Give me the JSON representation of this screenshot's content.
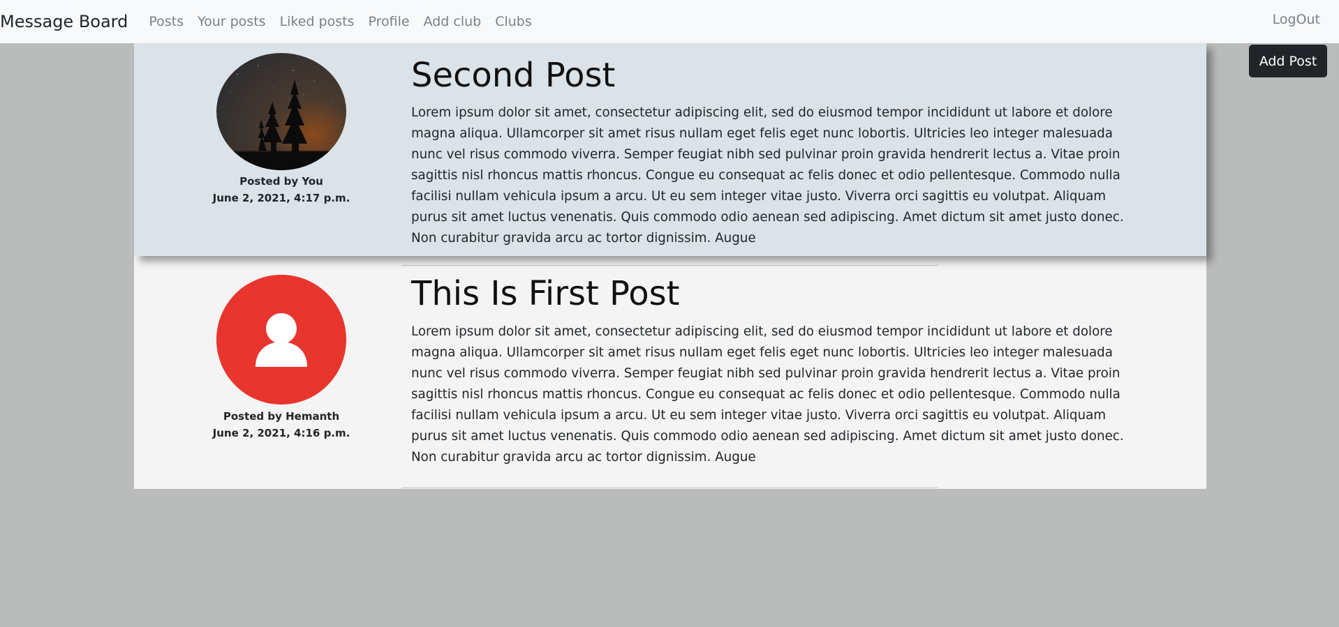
{
  "navbar": {
    "brand": "Message Board",
    "links": [
      "Posts",
      "Your posts",
      "Liked posts",
      "Profile",
      "Add club",
      "Clubs"
    ],
    "logout": "LogOut"
  },
  "add_post_label": "Add Post",
  "posts": [
    {
      "title": "Second Post",
      "posted_by": "Posted by You",
      "date": "June 2, 2021, 4:17 p.m.",
      "avatar": "night-forest-photo",
      "body": "Lorem ipsum dolor sit amet, consectetur adipiscing elit, sed do eiusmod tempor incididunt ut labore et dolore magna aliqua. Ullamcorper sit amet risus nullam eget felis eget nunc lobortis. Ultricies leo integer malesuada nunc vel risus commodo viverra. Semper feugiat nibh sed pulvinar proin gravida hendrerit lectus a. Vitae proin sagittis nisl rhoncus mattis rhoncus. Congue eu consequat ac felis donec et odio pellentesque. Commodo nulla facilisi nullam vehicula ipsum a arcu. Ut eu sem integer vitae justo. Viverra orci sagittis eu volutpat. Aliquam purus sit amet luctus venenatis. Quis commodo odio aenean sed adipiscing. Amet dictum sit amet justo donec. Non curabitur gravida arcu ac tortor dignissim. Augue"
    },
    {
      "title": "This Is First Post",
      "posted_by": "Posted by Hemanth",
      "date": "June 2, 2021, 4:16 p.m.",
      "avatar": "default-user-icon",
      "avatar_color": "#e8352d",
      "body": "Lorem ipsum dolor sit amet, consectetur adipiscing elit, sed do eiusmod tempor incididunt ut labore et dolore magna aliqua. Ullamcorper sit amet risus nullam eget felis eget nunc lobortis. Ultricies leo integer malesuada nunc vel risus commodo viverra. Semper feugiat nibh sed pulvinar proin gravida hendrerit lectus a. Vitae proin sagittis nisl rhoncus mattis rhoncus. Congue eu consequat ac felis donec et odio pellentesque. Commodo nulla facilisi nullam vehicula ipsum a arcu. Ut eu sem integer vitae justo. Viverra orci sagittis eu volutpat. Aliquam purus sit amet luctus venenatis. Quis commodo odio aenean sed adipiscing. Amet dictum sit amet justo donec. Non curabitur gravida arcu ac tortor dignissim. Augue"
    }
  ],
  "colors": {
    "navbar_bg": "#f8f9fa",
    "page_bg": "#babcbb",
    "post_highlight_bg": "#dbe3e8",
    "post_bg": "#f4f4f4",
    "button_bg": "#212529",
    "avatar_red": "#e8352d"
  }
}
